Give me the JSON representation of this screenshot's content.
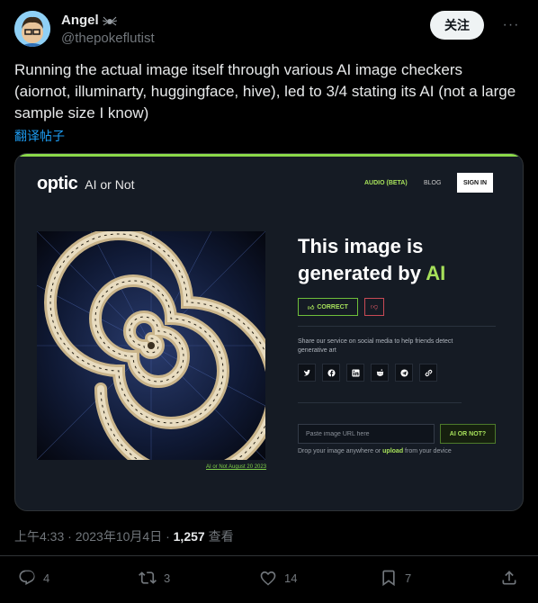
{
  "author": {
    "display_name": "Angel",
    "handle": "@thepokeflutist",
    "follow_label": "关注",
    "more_label": "···"
  },
  "tweet": {
    "text": "Running the actual image itself through various AI image checkers (aiornot, illuminarty, huggingface, hive), led to 3/4 stating its AI (not a large sample size I know)",
    "translate_label": "翻译帖子"
  },
  "screenshot": {
    "logo_word": "optic",
    "logo_sub": "AI or Not",
    "nav_audio": "AUDIO (BETA)",
    "nav_blog": "BLOG",
    "nav_signin": "SIGN IN",
    "result_line1": "This image is",
    "result_line2": "generated by ",
    "result_ai": "AI",
    "correct_label": "CORRECT",
    "share_text": "Share our service on social media to help friends detect generative art",
    "url_placeholder": "Paste image URL here",
    "ainot_label": "AI OR NOT?",
    "drop_prefix": "Drop your image anywhere or ",
    "drop_upload": "upload",
    "drop_suffix": " from your device",
    "art_caption": "AI or Not August 20 2023",
    "accent_color": "#a6e05a"
  },
  "meta": {
    "time": "上午4:33 · 2023年10月4日 · ",
    "views": "1,257",
    "views_label": " 查看"
  },
  "actions": {
    "replies": "4",
    "retweets": "3",
    "likes": "14",
    "bookmarks": "7"
  }
}
